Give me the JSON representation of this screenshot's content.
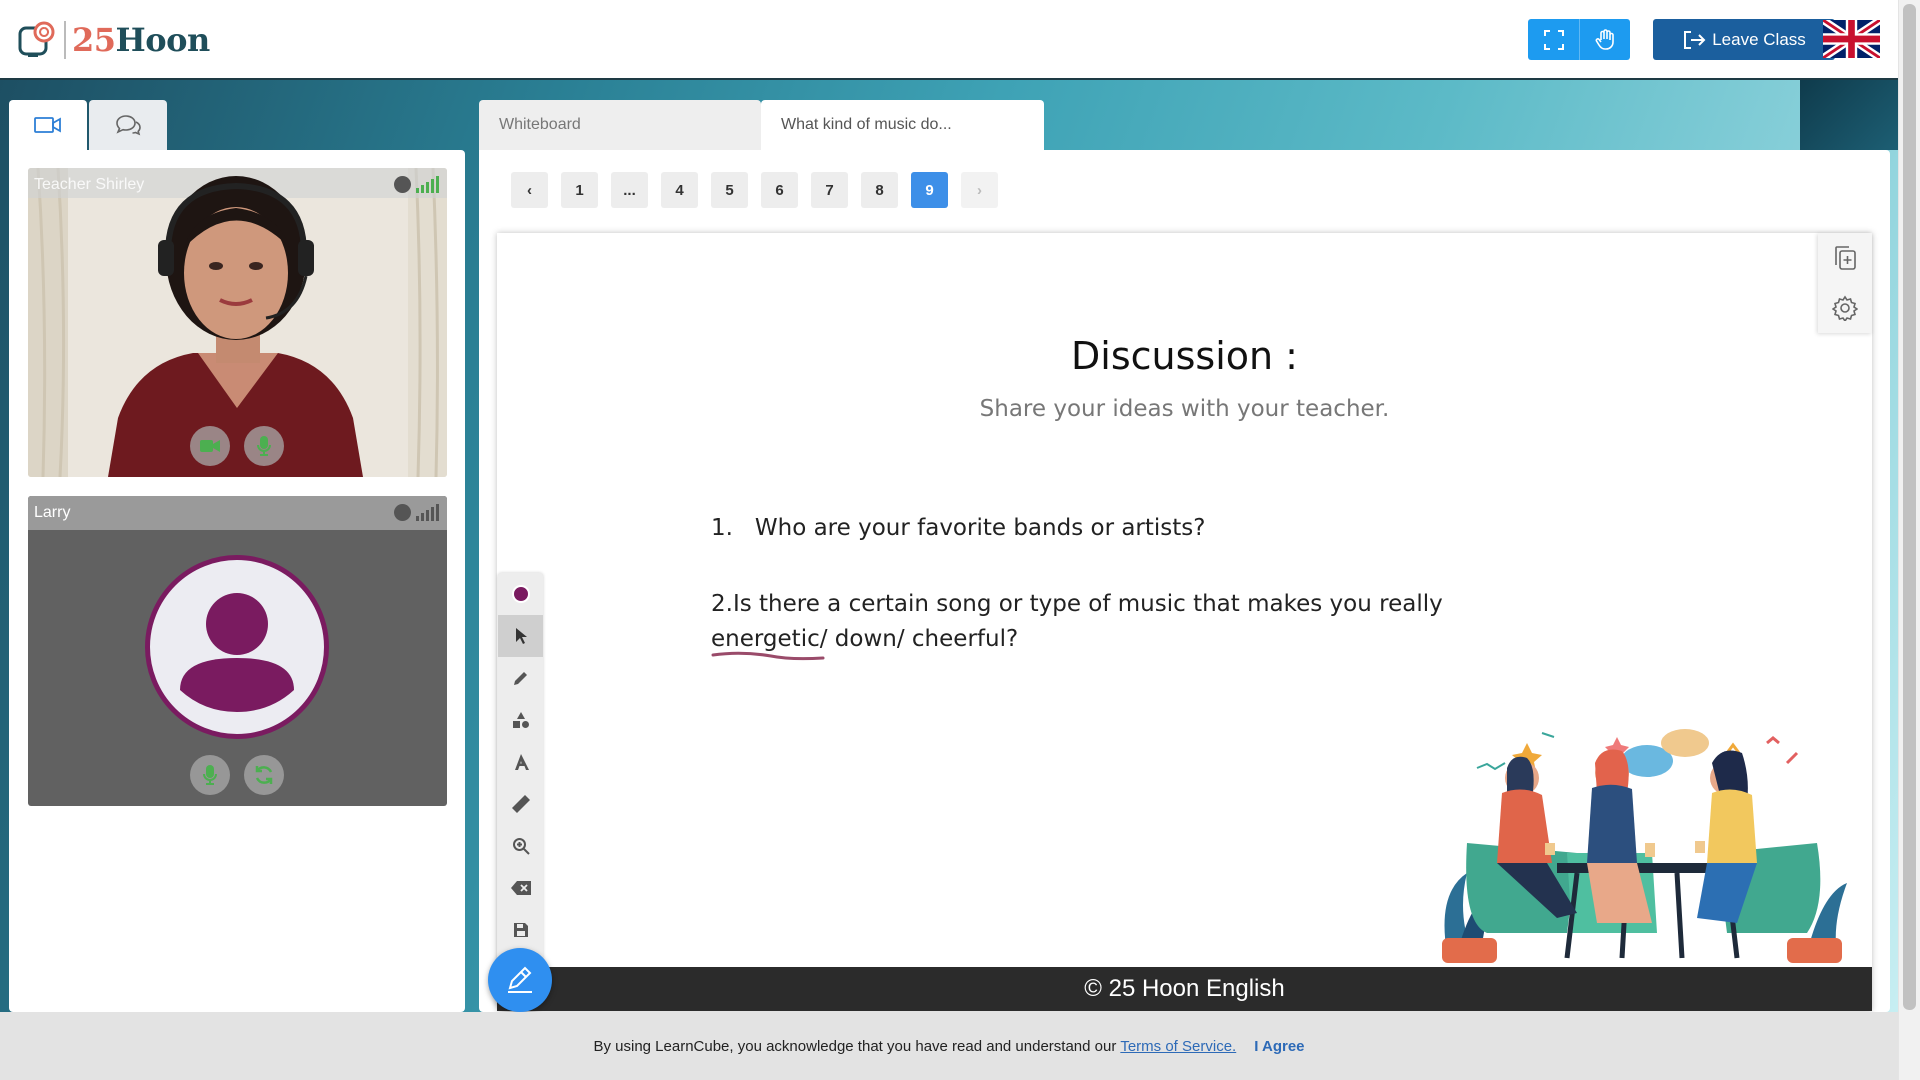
{
  "header": {
    "logo": {
      "number": "25",
      "word": "Hoon"
    },
    "buttons": [
      {
        "name": "fullscreen",
        "icon": "fullscreen-icon"
      },
      {
        "name": "raise-hand",
        "icon": "hand-icon"
      }
    ],
    "leave_label": "Leave Class",
    "language_flag": "uk-flag-icon"
  },
  "sidebar": {
    "tabs": [
      {
        "icon": "video-camera-icon",
        "active": true
      },
      {
        "icon": "chat-icon",
        "active": false
      }
    ],
    "participants": [
      {
        "name": "Teacher Shirley"
      },
      {
        "name": "Larry"
      }
    ]
  },
  "main": {
    "tabs": [
      {
        "label": "Whiteboard",
        "active": false
      },
      {
        "label": "What kind of music do...",
        "active": true
      }
    ],
    "pagination": {
      "prev": "‹",
      "pages": [
        "1",
        "...",
        "4",
        "5",
        "6",
        "7",
        "8",
        "9"
      ],
      "current": "9",
      "next": "›"
    },
    "slide": {
      "title": "Discussion :",
      "subtitle": "Share your ideas with your teacher.",
      "q1_num": "1.",
      "q1_text": "Who are your favorite bands or artists?",
      "q2_line1": "2.Is there a certain song or type of music that makes you  really",
      "q2_word": "energetic",
      "q2_rest": "/ down/ cheerful?",
      "footer": "© 25 Hoon English"
    }
  },
  "colors": {
    "accent": "#1d9bf0",
    "leave": "#1b5f9e",
    "avatar_ring": "#7a1b60",
    "page_active": "#3d8fe8",
    "footer_bg": "#2b2b2b"
  },
  "cookie": {
    "text": "By using LearnCube, you acknowledge that you have read and understand our",
    "link": "Terms of Service.",
    "agree": "I Agree"
  }
}
